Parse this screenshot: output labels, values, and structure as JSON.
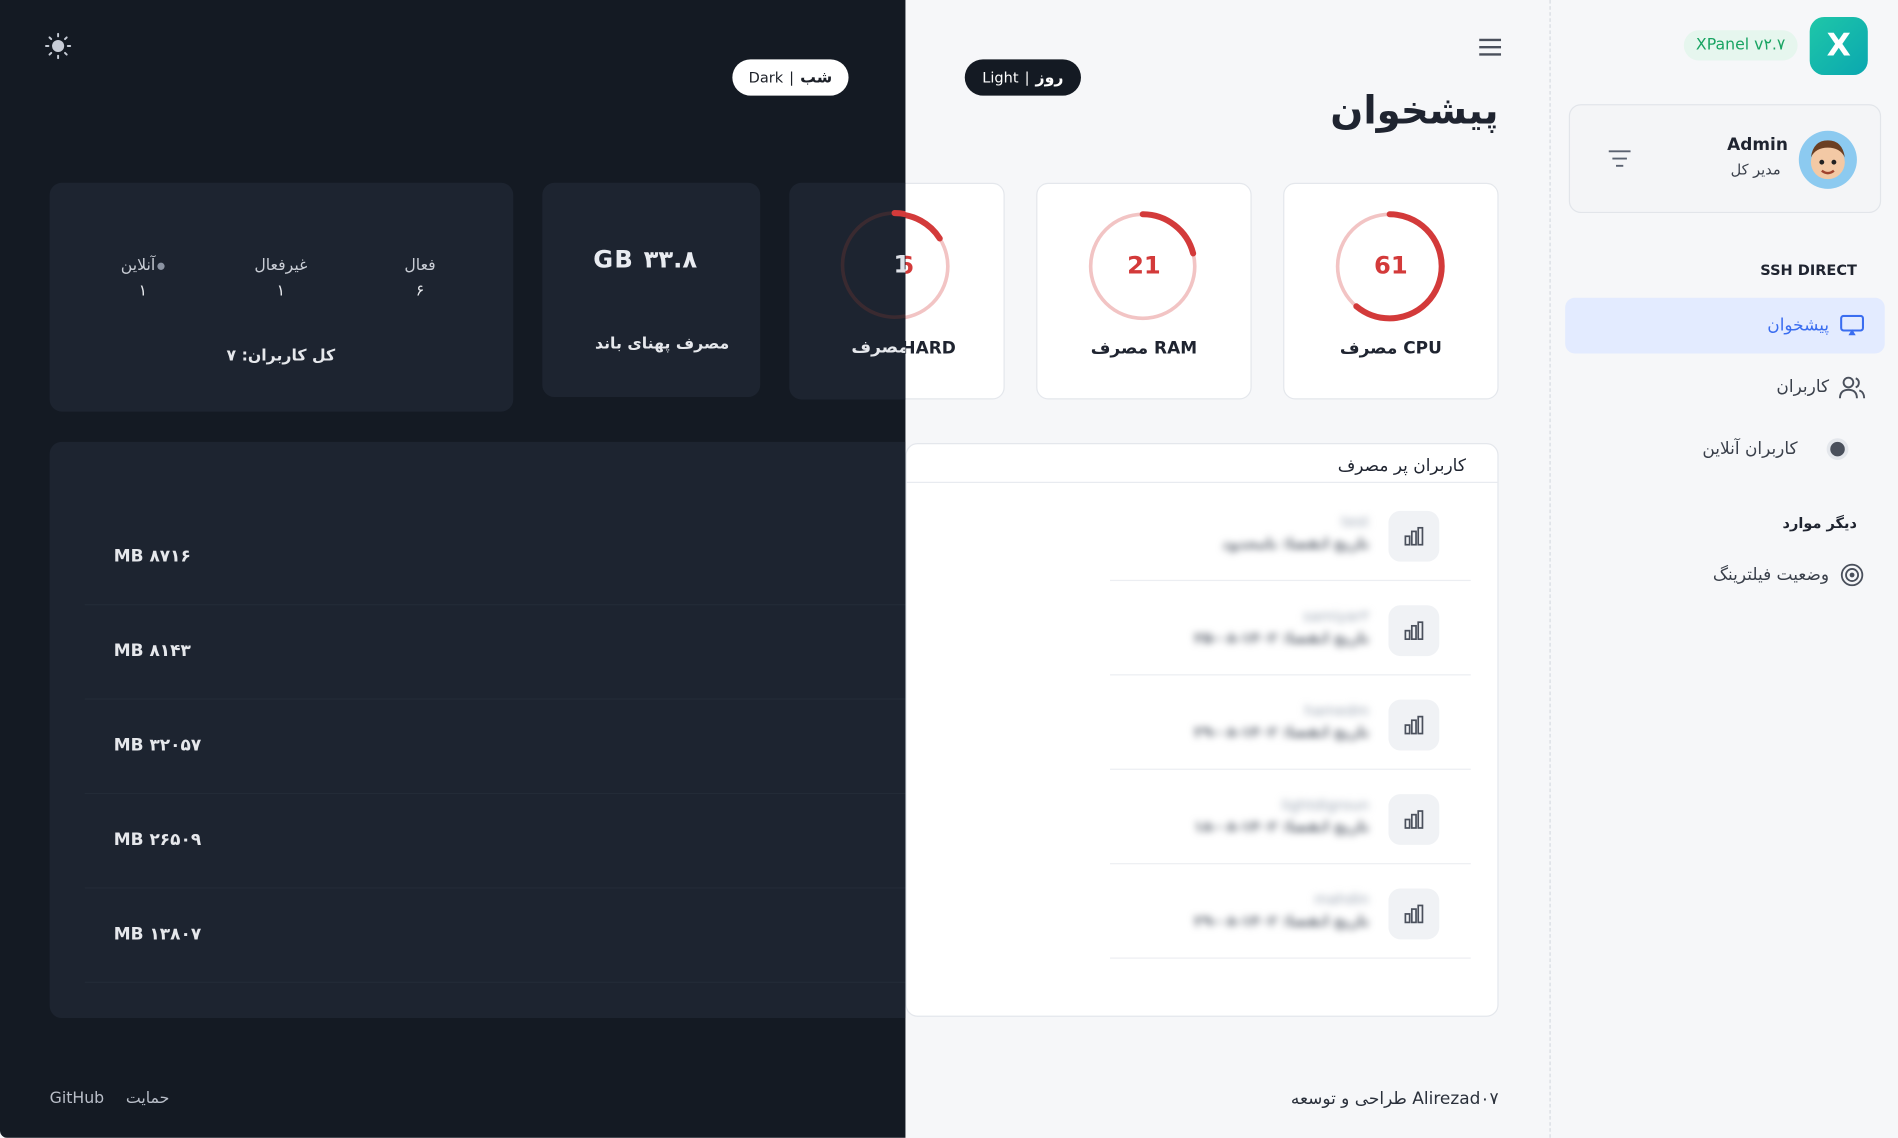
{
  "app": {
    "version": "XPanel v۲.۷",
    "logo_glyph": "X",
    "page_title": "پیشخوان",
    "brand_color": "#1fc7a8",
    "accent_color": "#3a6df0",
    "gauge_color": "#d33a3a"
  },
  "theme": {
    "dark_pill": {
      "label": "Dark",
      "label_fa": "شب"
    },
    "light_pill": {
      "label": "Light",
      "label_fa": "روز"
    }
  },
  "sidebar": {
    "user": {
      "name": "Admin",
      "role": "مدیر کل"
    },
    "section_ssh": "SSH DIRECT",
    "items": [
      {
        "label": "پیشخوان",
        "icon": "monitor-icon",
        "active": true
      },
      {
        "label": "کاربران",
        "icon": "users-icon",
        "active": false
      },
      {
        "label": "کاربران آنلاین",
        "icon": "online-dot-icon",
        "active": false
      }
    ],
    "section_other": "دیگر موارد",
    "other_items": [
      {
        "label": "وضعیت فیلترینگ",
        "icon": "target-icon"
      }
    ]
  },
  "stats": {
    "cpu": {
      "value": "61",
      "percent": 61,
      "label": "مصرف CPU"
    },
    "ram": {
      "value": "21",
      "percent": 21,
      "label": "مصرف RAM"
    },
    "hard": {
      "value": "16",
      "percent": 16,
      "label": "مصرف HARD"
    },
    "bandwidth": {
      "value": "GB ۳۳.۸",
      "label": "مصرف پهنای باند"
    },
    "users": {
      "active_label": "فعال",
      "active_value": "۶",
      "inactive_label": "غیرفعال",
      "inactive_value": "۱",
      "online_label": "آنلاین",
      "online_value": "۱",
      "total_label": "کل کاربران: ۷"
    }
  },
  "top_users": {
    "title": "کاربران پر مصرف",
    "rows": [
      {
        "name": "test",
        "date": "تاریخ انقضا: نامحدود",
        "usage": "MB ۸۷۱۶"
      },
      {
        "name": "samiyar۳",
        "date": "تاریخ انقضا: ۱۴۰۲-۰۸-۲۵",
        "usage": "MB ۸۱۴۳"
      },
      {
        "name": "hamedm",
        "date": "تاریخ انقضا: ۱۴۰۲-۰۸-۲۹",
        "usage": "MB ۳۲۰۵۷"
      },
      {
        "name": "lightdigroun",
        "date": "تاریخ انقضا: ۱۴۰۲-۰۸-۱۸",
        "usage": "MB ۲۶۵۰۹"
      },
      {
        "name": "mahdin",
        "date": "تاریخ انقضا: ۱۴۰۲-۰۸-۲۹",
        "usage": "MB ۱۳۸۰۷"
      }
    ]
  },
  "footer": {
    "credit": "طراحی و توسعه Alirezad۰۷",
    "github": "GitHub",
    "support": "حمایت"
  }
}
